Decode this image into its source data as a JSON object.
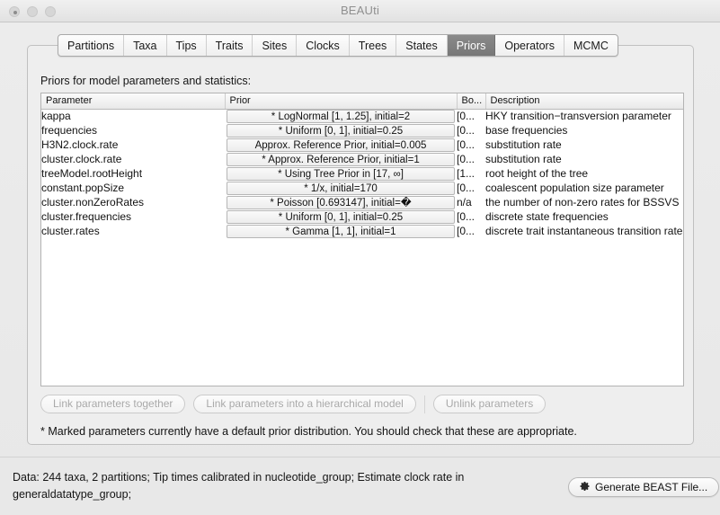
{
  "window": {
    "title": "BEAUti",
    "controls": [
      "close",
      "minimize",
      "zoom"
    ]
  },
  "tabs": [
    {
      "label": "Partitions",
      "selected": false
    },
    {
      "label": "Taxa",
      "selected": false
    },
    {
      "label": "Tips",
      "selected": false
    },
    {
      "label": "Traits",
      "selected": false
    },
    {
      "label": "Sites",
      "selected": false
    },
    {
      "label": "Clocks",
      "selected": false
    },
    {
      "label": "Trees",
      "selected": false
    },
    {
      "label": "States",
      "selected": false
    },
    {
      "label": "Priors",
      "selected": true
    },
    {
      "label": "Operators",
      "selected": false
    },
    {
      "label": "MCMC",
      "selected": false
    }
  ],
  "panel": {
    "title": "Priors for model parameters and statistics:"
  },
  "table": {
    "columns": [
      "Parameter",
      "Prior",
      "Bo...",
      "Description"
    ],
    "rows": [
      {
        "parameter": "kappa",
        "prior": "* LogNormal [1, 1.25], initial=2",
        "bound": "[0...",
        "description": "HKY transition−transversion parameter"
      },
      {
        "parameter": "frequencies",
        "prior": "* Uniform [0, 1], initial=0.25",
        "bound": "[0...",
        "description": "base frequencies"
      },
      {
        "parameter": "H3N2.clock.rate",
        "prior": "Approx. Reference Prior, initial=0.005",
        "bound": "[0...",
        "description": "substitution rate"
      },
      {
        "parameter": "cluster.clock.rate",
        "prior": "* Approx. Reference Prior, initial=1",
        "bound": "[0...",
        "description": "substitution rate"
      },
      {
        "parameter": "treeModel.rootHeight",
        "prior": "* Using Tree Prior in [17, ∞]",
        "bound": "[1...",
        "description": "root height of the tree"
      },
      {
        "parameter": "constant.popSize",
        "prior": "* 1/x, initial=170",
        "bound": "[0...",
        "description": "coalescent population size parameter"
      },
      {
        "parameter": "cluster.nonZeroRates",
        "prior": "* Poisson [0.693147], initial=�",
        "bound": "n/a",
        "description": "the number of non-zero rates for BSSVS"
      },
      {
        "parameter": "cluster.frequencies",
        "prior": "* Uniform [0, 1], initial=0.25",
        "bound": "[0...",
        "description": "discrete state frequencies"
      },
      {
        "parameter": "cluster.rates",
        "prior": "* Gamma [1, 1], initial=1",
        "bound": "[0...",
        "description": "discrete trait instantaneous transition rates"
      }
    ]
  },
  "actions": {
    "link_together": "Link parameters together",
    "link_hierarchical": "Link parameters into a hierarchical model",
    "unlink": "Unlink parameters"
  },
  "footnote": "* Marked parameters currently have a default prior distribution. You should check that these are appropriate.",
  "status": {
    "text": "Data: 244 taxa, 2 partitions; Tip times calibrated in nucleotide_group; Estimate clock rate in generaldatatype_group;"
  },
  "generate_button": {
    "label": "Generate BEAST File...",
    "icon": "gear-icon"
  }
}
